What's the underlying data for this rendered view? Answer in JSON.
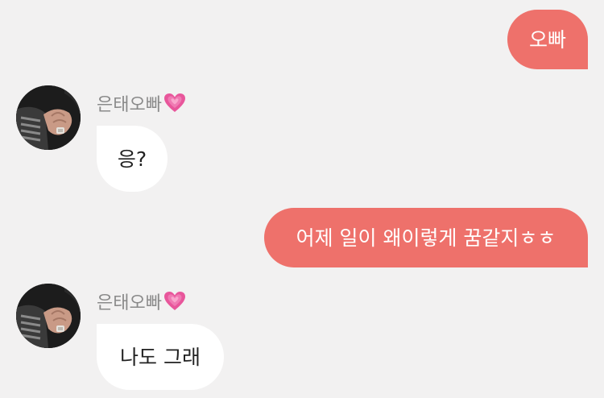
{
  "messages": [
    {
      "from": "me",
      "text": "오빠"
    },
    {
      "from": "them",
      "sender": "은태오빠",
      "sender_icon": "growing-heart-icon",
      "text": "응?"
    },
    {
      "from": "me",
      "text": "어제 일이 왜이렇게 꿈같지ㅎㅎ"
    },
    {
      "from": "them",
      "sender": "은태오빠",
      "sender_icon": "growing-heart-icon",
      "text": "나도 그래"
    }
  ],
  "colors": {
    "background": "#f2f1f1",
    "my_bubble": "#ee716b",
    "their_bubble": "#ffffff",
    "sender_name": "#8a8a8a",
    "heart": "#e8569b"
  }
}
